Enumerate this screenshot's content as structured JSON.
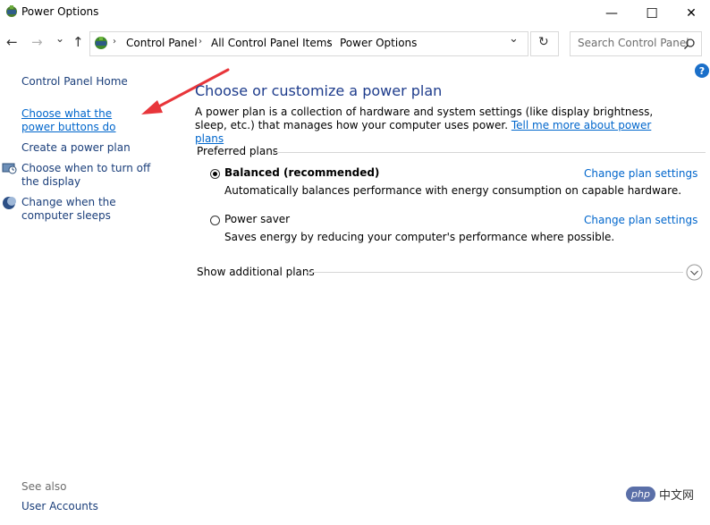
{
  "window": {
    "title": "Power Options",
    "minimize": "—",
    "maximize": "☐",
    "close": "✕"
  },
  "nav": {
    "back": "←",
    "forward": "→",
    "recent": "⌄",
    "up": "↑",
    "breadcrumbs": [
      "Control Panel",
      "All Control Panel Items",
      "Power Options"
    ],
    "separator": "›",
    "dropdown": "⌄",
    "refresh": "↻"
  },
  "search": {
    "placeholder": "Search Control Panel",
    "icon": "search-icon"
  },
  "help": "?",
  "sidebar": {
    "home": "Control Panel Home",
    "items": [
      {
        "label": "Choose what the power buttons do"
      },
      {
        "label": "Create a power plan"
      },
      {
        "label": "Choose when to turn off the display"
      },
      {
        "label": "Change when the computer sleeps"
      }
    ],
    "see_also": "See also",
    "see_also_items": [
      "User Accounts"
    ]
  },
  "main": {
    "heading": "Choose or customize a power plan",
    "intro": "A power plan is a collection of hardware and system settings (like display brightness, sleep, etc.) that manages how your computer uses power.",
    "learn_more": "Tell me more about power plans",
    "preferred_plans": "Preferred plans",
    "plans": [
      {
        "name": "Balanced (recommended)",
        "description": "Automatically balances performance with energy consumption on capable hardware.",
        "selected": true,
        "change_link": "Change plan settings"
      },
      {
        "name": "Power saver",
        "description": "Saves energy by reducing your computer's performance where possible.",
        "selected": false,
        "change_link": "Change plan settings"
      }
    ],
    "show_additional": "Show additional plans"
  },
  "watermark": "php中文网",
  "colors": {
    "link": "#0066cc",
    "heading": "#1e3c8c",
    "arrow": "#e8353a"
  }
}
